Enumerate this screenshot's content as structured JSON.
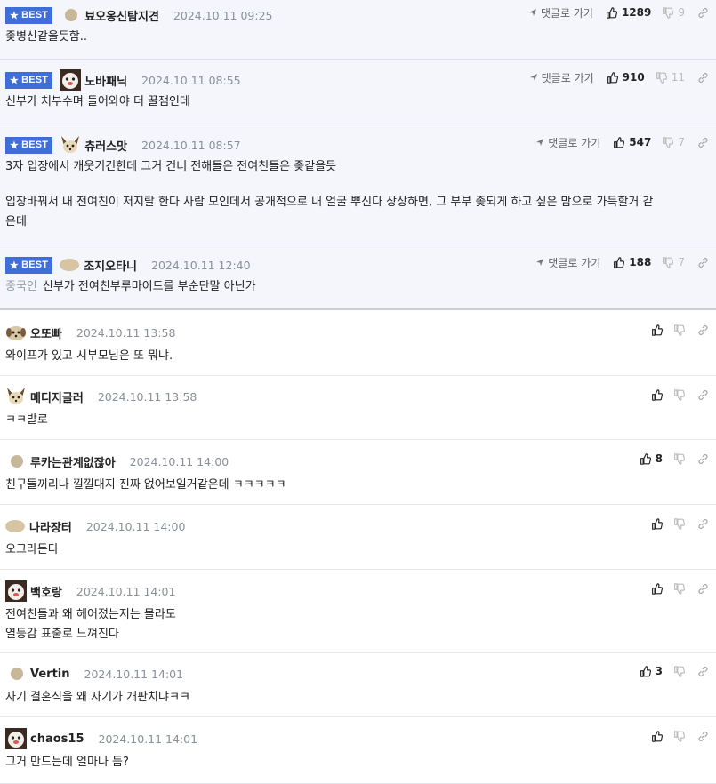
{
  "labels": {
    "best": "BEST",
    "reply": "댓글로 가기"
  },
  "best_comments": [
    {
      "nick": "뵤오옹신탐지견",
      "time": "2024.10.11 09:25",
      "up": "1289",
      "down": "9",
      "avatar": "dot",
      "lines": [
        "좆병신같을듯함.."
      ]
    },
    {
      "nick": "노바패닉",
      "time": "2024.10.11 08:55",
      "up": "910",
      "down": "11",
      "avatar": "dog",
      "lines": [
        "신부가 처부수며 들어와야 더 꿀잼인데"
      ]
    },
    {
      "nick": "츄러스맛",
      "time": "2024.10.11 08:57",
      "up": "547",
      "down": "7",
      "avatar": "fox",
      "lines": [
        "3자 입장에서 개웃기긴한데 그거 건너 전해들은 전여친들은 좆같을듯",
        "",
        "입장바꿔서 내 전여친이 저지랄 한다 사람 모인데서 공개적으로 내 얼굴 뿌신다 상상하면, 그 부부 좆되게 하고 싶은 맘으로 가득할거 같",
        "은데"
      ]
    },
    {
      "nick": "조지오타니",
      "time": "2024.10.11 12:40",
      "up": "188",
      "down": "7",
      "avatar": "blob",
      "prefix": "중국인",
      "lines": [
        "신부가 전여친부루마이드를 부순단말 아닌가"
      ]
    }
  ],
  "comments": [
    {
      "nick": "오또빠",
      "time": "2024.10.11 13:58",
      "up": "",
      "down": "",
      "avatar": "pup",
      "lines": [
        "와이프가 있고 시부모님은 또 뭐냐."
      ]
    },
    {
      "nick": "메디지글러",
      "time": "2024.10.11 13:58",
      "up": "",
      "down": "",
      "avatar": "fox",
      "lines": [
        "ㅋㅋ발로"
      ]
    },
    {
      "nick": "루카는관계없잖아",
      "time": "2024.10.11 14:00",
      "up": "8",
      "down": "",
      "avatar": "dot",
      "lines": [
        "친구들끼리나 낄낄대지 진짜 없어보일거같은데 ㅋㅋㅋㅋㅋ"
      ]
    },
    {
      "nick": "나라장터",
      "time": "2024.10.11 14:00",
      "up": "",
      "down": "",
      "avatar": "blob",
      "lines": [
        "오그라든다"
      ]
    },
    {
      "nick": "백호랑",
      "time": "2024.10.11 14:01",
      "up": "",
      "down": "",
      "avatar": "dog",
      "lines": [
        "전여친들과 왜 헤어졌는지는 몰라도",
        "열등감 표출로 느껴진다"
      ]
    },
    {
      "nick": "Vertin",
      "time": "2024.10.11 14:01",
      "up": "3",
      "down": "",
      "avatar": "dot",
      "lines": [
        "자기 결혼식을 왜 자기가 개판치냐ㅋㅋ"
      ]
    },
    {
      "nick": "chaos15",
      "time": "2024.10.11 14:01",
      "up": "",
      "down": "",
      "avatar": "dog",
      "lines": [
        "그거 만드는데 얼마나 듬?"
      ]
    }
  ],
  "colors": {
    "best_bg": "#f4f6fb",
    "badge": "#3f6fd6",
    "time": "#8a8f98"
  }
}
